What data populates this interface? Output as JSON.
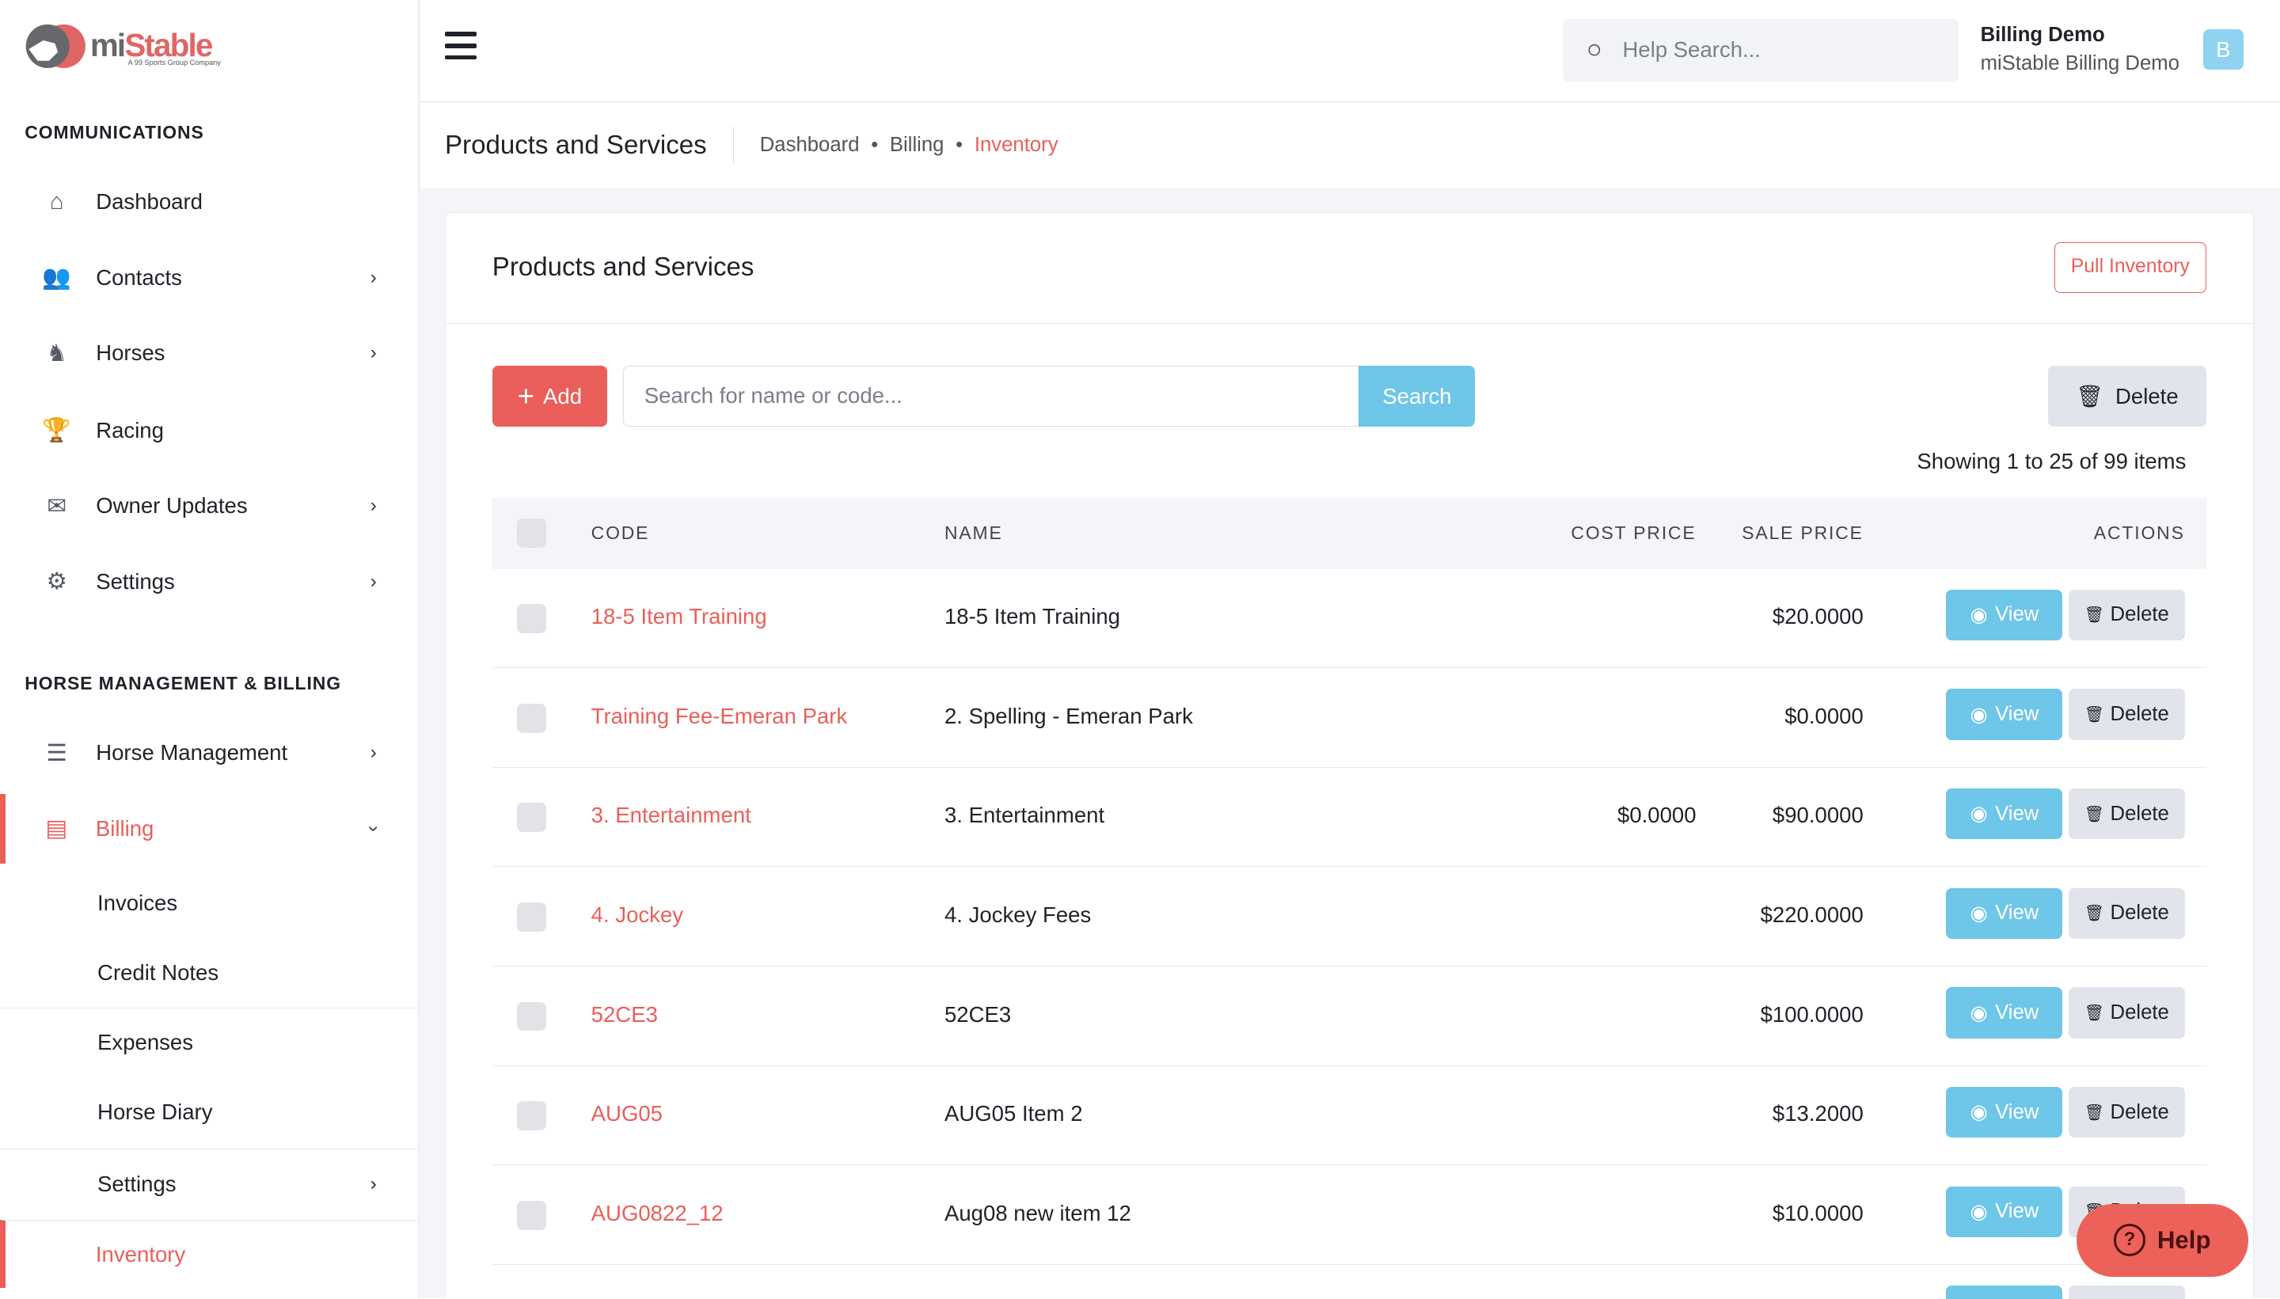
{
  "brand": {
    "logo_text_1": "mi",
    "logo_text_2": "Stable",
    "logo_tagline": "A 99 Sports Group Company",
    "accent": "#ea5f5a",
    "info": "#6ec6e8"
  },
  "sidebar": {
    "section1": "COMMUNICATIONS",
    "items1": [
      {
        "label": "Dashboard",
        "icon": "home-icon"
      },
      {
        "label": "Contacts",
        "icon": "users-icon"
      },
      {
        "label": "Horses",
        "icon": "horse-icon"
      },
      {
        "label": "Racing",
        "icon": "trophy-icon"
      },
      {
        "label": "Owner Updates",
        "icon": "envelope-icon"
      },
      {
        "label": "Settings",
        "icon": "gears-icon"
      }
    ],
    "section2": "HORSE MANAGEMENT & BILLING",
    "items2": [
      {
        "label": "Horse Management",
        "icon": "list-icon"
      },
      {
        "label": "Billing",
        "icon": "file-invoice-icon"
      }
    ],
    "billing_sub": [
      "Invoices",
      "Credit Notes",
      "Expenses",
      "Horse Diary",
      "Settings",
      "Inventory"
    ]
  },
  "topbar": {
    "search_placeholder": "Help Search...",
    "user_name": "Billing Demo",
    "user_org": "miStable Billing Demo",
    "avatar_letter": "B"
  },
  "header": {
    "title": "Products and Services",
    "breadcrumb": [
      "Dashboard",
      "Billing",
      "Inventory"
    ]
  },
  "card": {
    "title": "Products and Services",
    "pull_label": "Pull Inventory",
    "add_label": "Add",
    "search_placeholder": "Search for name or code...",
    "search_label": "Search",
    "delete_label": "Delete",
    "showing": "Showing 1 to 25 of 99 items"
  },
  "table": {
    "headers": {
      "code": "CODE",
      "name": "NAME",
      "cost": "COST PRICE",
      "sale": "SALE PRICE",
      "actions": "ACTIONS"
    },
    "view_label": "View",
    "delete_label": "Delete",
    "rows": [
      {
        "code": "18-5 Item Training",
        "name": "18-5 Item Training",
        "cost": "",
        "sale": "$20.0000"
      },
      {
        "code": "Training Fee-Emeran Park",
        "name": "2. Spelling - Emeran Park",
        "cost": "",
        "sale": "$0.0000"
      },
      {
        "code": "3. Entertainment",
        "name": "3. Entertainment",
        "cost": "$0.0000",
        "sale": "$90.0000"
      },
      {
        "code": "4. Jockey",
        "name": "4. Jockey Fees",
        "cost": "",
        "sale": "$220.0000"
      },
      {
        "code": "52CE3",
        "name": "52CE3",
        "cost": "",
        "sale": "$100.0000"
      },
      {
        "code": "AUG05",
        "name": "AUG05 Item 2",
        "cost": "",
        "sale": "$13.2000"
      },
      {
        "code": "AUG0822_12",
        "name": "Aug08 new item 12",
        "cost": "",
        "sale": "$10.0000"
      }
    ]
  },
  "help_label": "Help"
}
